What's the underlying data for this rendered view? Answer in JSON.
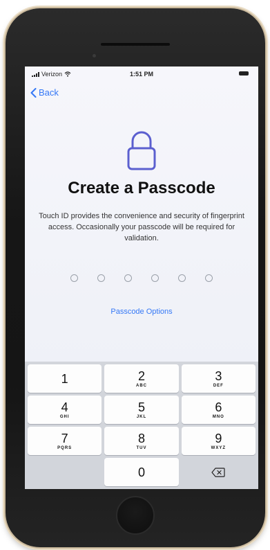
{
  "status_bar": {
    "carrier": "Verizon",
    "time": "1:51 PM"
  },
  "nav": {
    "back_label": "Back"
  },
  "passcode": {
    "title": "Create a Passcode",
    "description": "Touch ID provides the convenience and security of fingerprint access. Occasionally your passcode will be required for validation.",
    "digits_entered": 0,
    "digits_total": 6,
    "options_label": "Passcode Options"
  },
  "keypad": {
    "keys": [
      {
        "digit": "1",
        "letters": ""
      },
      {
        "digit": "2",
        "letters": "ABC"
      },
      {
        "digit": "3",
        "letters": "DEF"
      },
      {
        "digit": "4",
        "letters": "GHI"
      },
      {
        "digit": "5",
        "letters": "JKL"
      },
      {
        "digit": "6",
        "letters": "MNO"
      },
      {
        "digit": "7",
        "letters": "PQRS"
      },
      {
        "digit": "8",
        "letters": "TUV"
      },
      {
        "digit": "9",
        "letters": "WXYZ"
      },
      {
        "digit": "0",
        "letters": ""
      }
    ],
    "delete_icon": "backspace-icon"
  },
  "colors": {
    "accent": "#3478f6",
    "lock_icon": "#5b5fcf"
  }
}
